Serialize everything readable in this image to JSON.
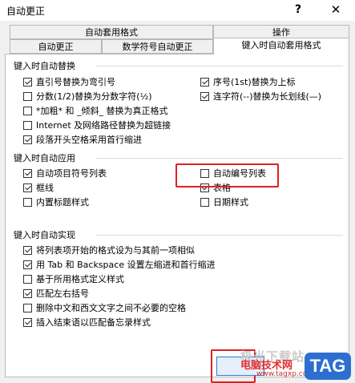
{
  "window": {
    "title": "自动更正",
    "help": "?",
    "close": "✕"
  },
  "tabs_top": [
    "自动套用格式",
    "操作"
  ],
  "tabs_bottom": [
    "自动更正",
    "数学符号自动更正",
    "键入时自动套用格式"
  ],
  "sections": {
    "replace": {
      "label": "键入时自动替换",
      "items": [
        {
          "label": "直引号替换为弯引号",
          "checked": true
        },
        {
          "label": "分数(1/2)替换为分数字符(½)",
          "checked": false
        },
        {
          "label": "*加粗* 和 _倾斜_ 替换为真正格式",
          "checked": false
        },
        {
          "label": "Internet 及网络路径替换为超链接",
          "checked": false
        },
        {
          "label": "段落开头空格采用首行缩进",
          "checked": true
        },
        {
          "label": "序号(1st)替换为上标",
          "checked": true
        },
        {
          "label": "连字符(--)替换为长划线(—)",
          "checked": true
        }
      ]
    },
    "apply": {
      "label": "键入时自动应用",
      "items": [
        {
          "label": "自动项目符号列表",
          "checked": true
        },
        {
          "label": "框线",
          "checked": true
        },
        {
          "label": "内置标题样式",
          "checked": false
        },
        {
          "label": "自动编号列表",
          "checked": false
        },
        {
          "label": "表格",
          "checked": true
        },
        {
          "label": "日期样式",
          "checked": false
        }
      ]
    },
    "automatic": {
      "label": "键入时自动实现",
      "items": [
        {
          "label": "将列表项开始的格式设为与其前一项相似",
          "checked": true
        },
        {
          "label": "用 Tab 和 Backspace 设置左缩进和首行缩进",
          "checked": true
        },
        {
          "label": "基于所用格式定义样式",
          "checked": false
        },
        {
          "label": "匹配左右括号",
          "checked": true
        },
        {
          "label": "删除中文和西文文字之间不必要的空格",
          "checked": false
        },
        {
          "label": "插入结束语以匹配备忘录样式",
          "checked": true
        }
      ]
    }
  },
  "watermark": {
    "line1": "极光下载站",
    "line2": "电脑技术网",
    "line3": "www.tagxp.com",
    "tag": "TAG"
  }
}
